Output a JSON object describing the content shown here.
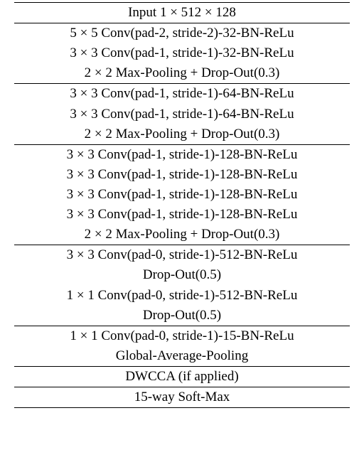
{
  "groups": [
    {
      "rows": [
        "Input 1 × 512 × 128"
      ]
    },
    {
      "rows": [
        "5 × 5 Conv(pad-2, stride-2)-32-BN-ReLu",
        "3 × 3 Conv(pad-1, stride-1)-32-BN-ReLu",
        "2 × 2 Max-Pooling + Drop-Out(0.3)"
      ]
    },
    {
      "rows": [
        "3 × 3 Conv(pad-1, stride-1)-64-BN-ReLu",
        "3 × 3 Conv(pad-1, stride-1)-64-BN-ReLu",
        "2 × 2 Max-Pooling + Drop-Out(0.3)"
      ]
    },
    {
      "rows": [
        "3 × 3 Conv(pad-1, stride-1)-128-BN-ReLu",
        "3 × 3 Conv(pad-1, stride-1)-128-BN-ReLu",
        "3 × 3 Conv(pad-1, stride-1)-128-BN-ReLu",
        "3 × 3 Conv(pad-1, stride-1)-128-BN-ReLu",
        "2 × 2 Max-Pooling + Drop-Out(0.3)"
      ]
    },
    {
      "rows": [
        "3 × 3 Conv(pad-0, stride-1)-512-BN-ReLu",
        "Drop-Out(0.5)",
        "1 × 1 Conv(pad-0, stride-1)-512-BN-ReLu",
        "Drop-Out(0.5)"
      ]
    },
    {
      "rows": [
        "1 × 1 Conv(pad-0, stride-1)-15-BN-ReLu",
        "Global-Average-Pooling"
      ]
    },
    {
      "rows": [
        "DWCCA (if applied)"
      ]
    },
    {
      "rows": [
        "15-way Soft-Max"
      ]
    }
  ]
}
